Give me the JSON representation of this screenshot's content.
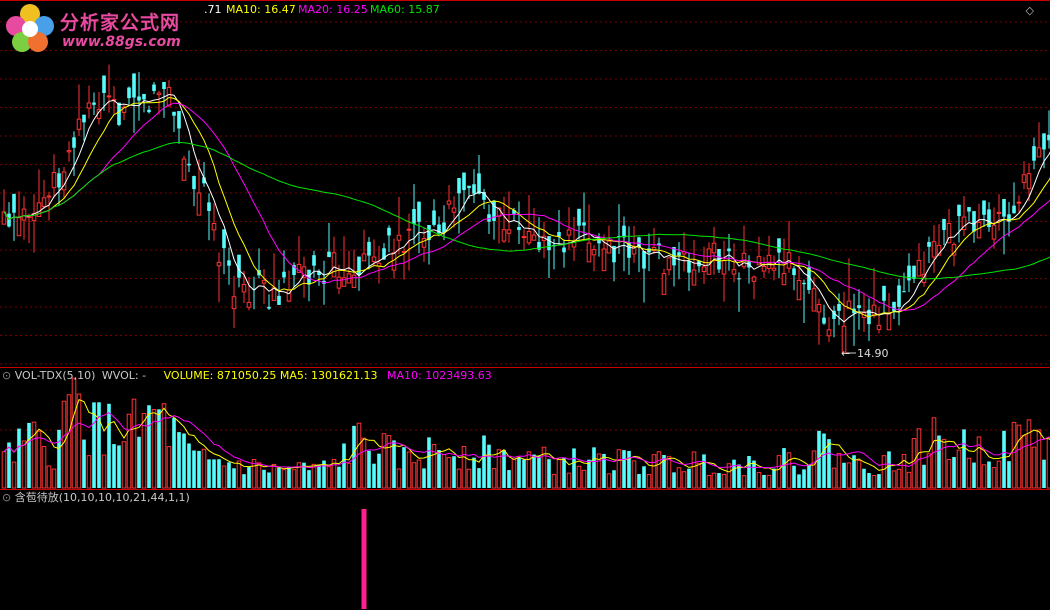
{
  "main_panel": {
    "header": {
      "ma5_tail": ".71",
      "ma10": "MA10: 16.47",
      "ma20": "MA20: 16.25",
      "ma60": "MA60: 15.87"
    },
    "low_annotation": "14.90",
    "colors": {
      "up": "#ff3232",
      "down": "#54fcfc",
      "ma5": "#ffffff",
      "ma10": "#ffff00",
      "ma20": "#ff00ff",
      "ma60": "#00e600",
      "grid": "#7a0000"
    }
  },
  "volume_panel": {
    "indicator": "VOL-TDX(5,10)",
    "wvol": "WVOL: -",
    "volume": "VOLUME: 871050.25",
    "ma5": "MA5: 1301621.13",
    "ma10": "MA10: 1023493.63"
  },
  "signal_panel": {
    "indicator": "含苞待放(10,10,10,10,21,44,1,1)"
  },
  "logo": {
    "title": "分析家公式网",
    "url": "www.88gs.com"
  },
  "chart_data": [
    {
      "type": "candlestick",
      "panel": "price",
      "series": [
        {
          "name": "MA10",
          "color": "#ffff00"
        },
        {
          "name": "MA20",
          "color": "#ff00ff"
        },
        {
          "name": "MA60",
          "color": "#00e600"
        }
      ],
      "ylim": [
        14.5,
        19.5
      ],
      "annotations": [
        {
          "label": "14.90",
          "value": 14.9
        }
      ],
      "anchors": [
        [
          0,
          16.5
        ],
        [
          3,
          16.7
        ],
        [
          8,
          16.8
        ],
        [
          12,
          17.1
        ],
        [
          15,
          17.9
        ],
        [
          20,
          18.1
        ],
        [
          25,
          18.0
        ],
        [
          30,
          18.2
        ],
        [
          33,
          18.4
        ],
        [
          36,
          17.4
        ],
        [
          40,
          16.8
        ],
        [
          43,
          16.0
        ],
        [
          46,
          15.6
        ],
        [
          50,
          15.5
        ],
        [
          55,
          15.4
        ],
        [
          60,
          15.7
        ],
        [
          66,
          15.8
        ],
        [
          72,
          15.9
        ],
        [
          78,
          16.1
        ],
        [
          84,
          16.4
        ],
        [
          88,
          16.5
        ],
        [
          91,
          16.8
        ],
        [
          94,
          16.9
        ],
        [
          98,
          16.6
        ],
        [
          102,
          16.4
        ],
        [
          106,
          16.2
        ],
        [
          110,
          16.1
        ],
        [
          114,
          16.2
        ],
        [
          118,
          16.2
        ],
        [
          122,
          16.1
        ],
        [
          126,
          16.0
        ],
        [
          130,
          16.0
        ],
        [
          134,
          15.9
        ],
        [
          138,
          15.8
        ],
        [
          142,
          16.0
        ],
        [
          146,
          15.9
        ],
        [
          150,
          15.8
        ],
        [
          154,
          15.9
        ],
        [
          158,
          15.8
        ],
        [
          162,
          15.4
        ],
        [
          166,
          15.0
        ],
        [
          170,
          15.3
        ],
        [
          174,
          15.2
        ],
        [
          178,
          15.1
        ],
        [
          182,
          15.6
        ],
        [
          185,
          16.0
        ],
        [
          188,
          16.3
        ],
        [
          192,
          16.4
        ],
        [
          196,
          16.5
        ],
        [
          200,
          16.4
        ],
        [
          203,
          16.8
        ],
        [
          207,
          17.4
        ],
        [
          210,
          17.8
        ]
      ]
    },
    {
      "type": "bar",
      "panel": "volume",
      "series": [
        {
          "name": "MA5",
          "color": "#ffff00"
        },
        {
          "name": "MA10",
          "color": "#ff00ff"
        }
      ],
      "anchors": [
        [
          0,
          700
        ],
        [
          5,
          1200
        ],
        [
          10,
          900
        ],
        [
          14,
          2300
        ],
        [
          17,
          1600
        ],
        [
          22,
          1400
        ],
        [
          28,
          1500
        ],
        [
          30,
          1900
        ],
        [
          34,
          1300
        ],
        [
          38,
          700
        ],
        [
          45,
          600
        ],
        [
          55,
          450
        ],
        [
          65,
          500
        ],
        [
          71,
          1200
        ],
        [
          80,
          700
        ],
        [
          88,
          1000
        ],
        [
          94,
          900
        ],
        [
          100,
          800
        ],
        [
          110,
          650
        ],
        [
          120,
          700
        ],
        [
          130,
          600
        ],
        [
          140,
          650
        ],
        [
          150,
          600
        ],
        [
          160,
          700
        ],
        [
          163,
          1100
        ],
        [
          170,
          600
        ],
        [
          180,
          650
        ],
        [
          185,
          1200
        ],
        [
          192,
          1000
        ],
        [
          200,
          1000
        ],
        [
          206,
          1400
        ],
        [
          210,
          1000
        ]
      ]
    },
    {
      "type": "bar",
      "panel": "signal",
      "signal_bars": [
        {
          "index": 72,
          "value": 1
        }
      ]
    }
  ]
}
